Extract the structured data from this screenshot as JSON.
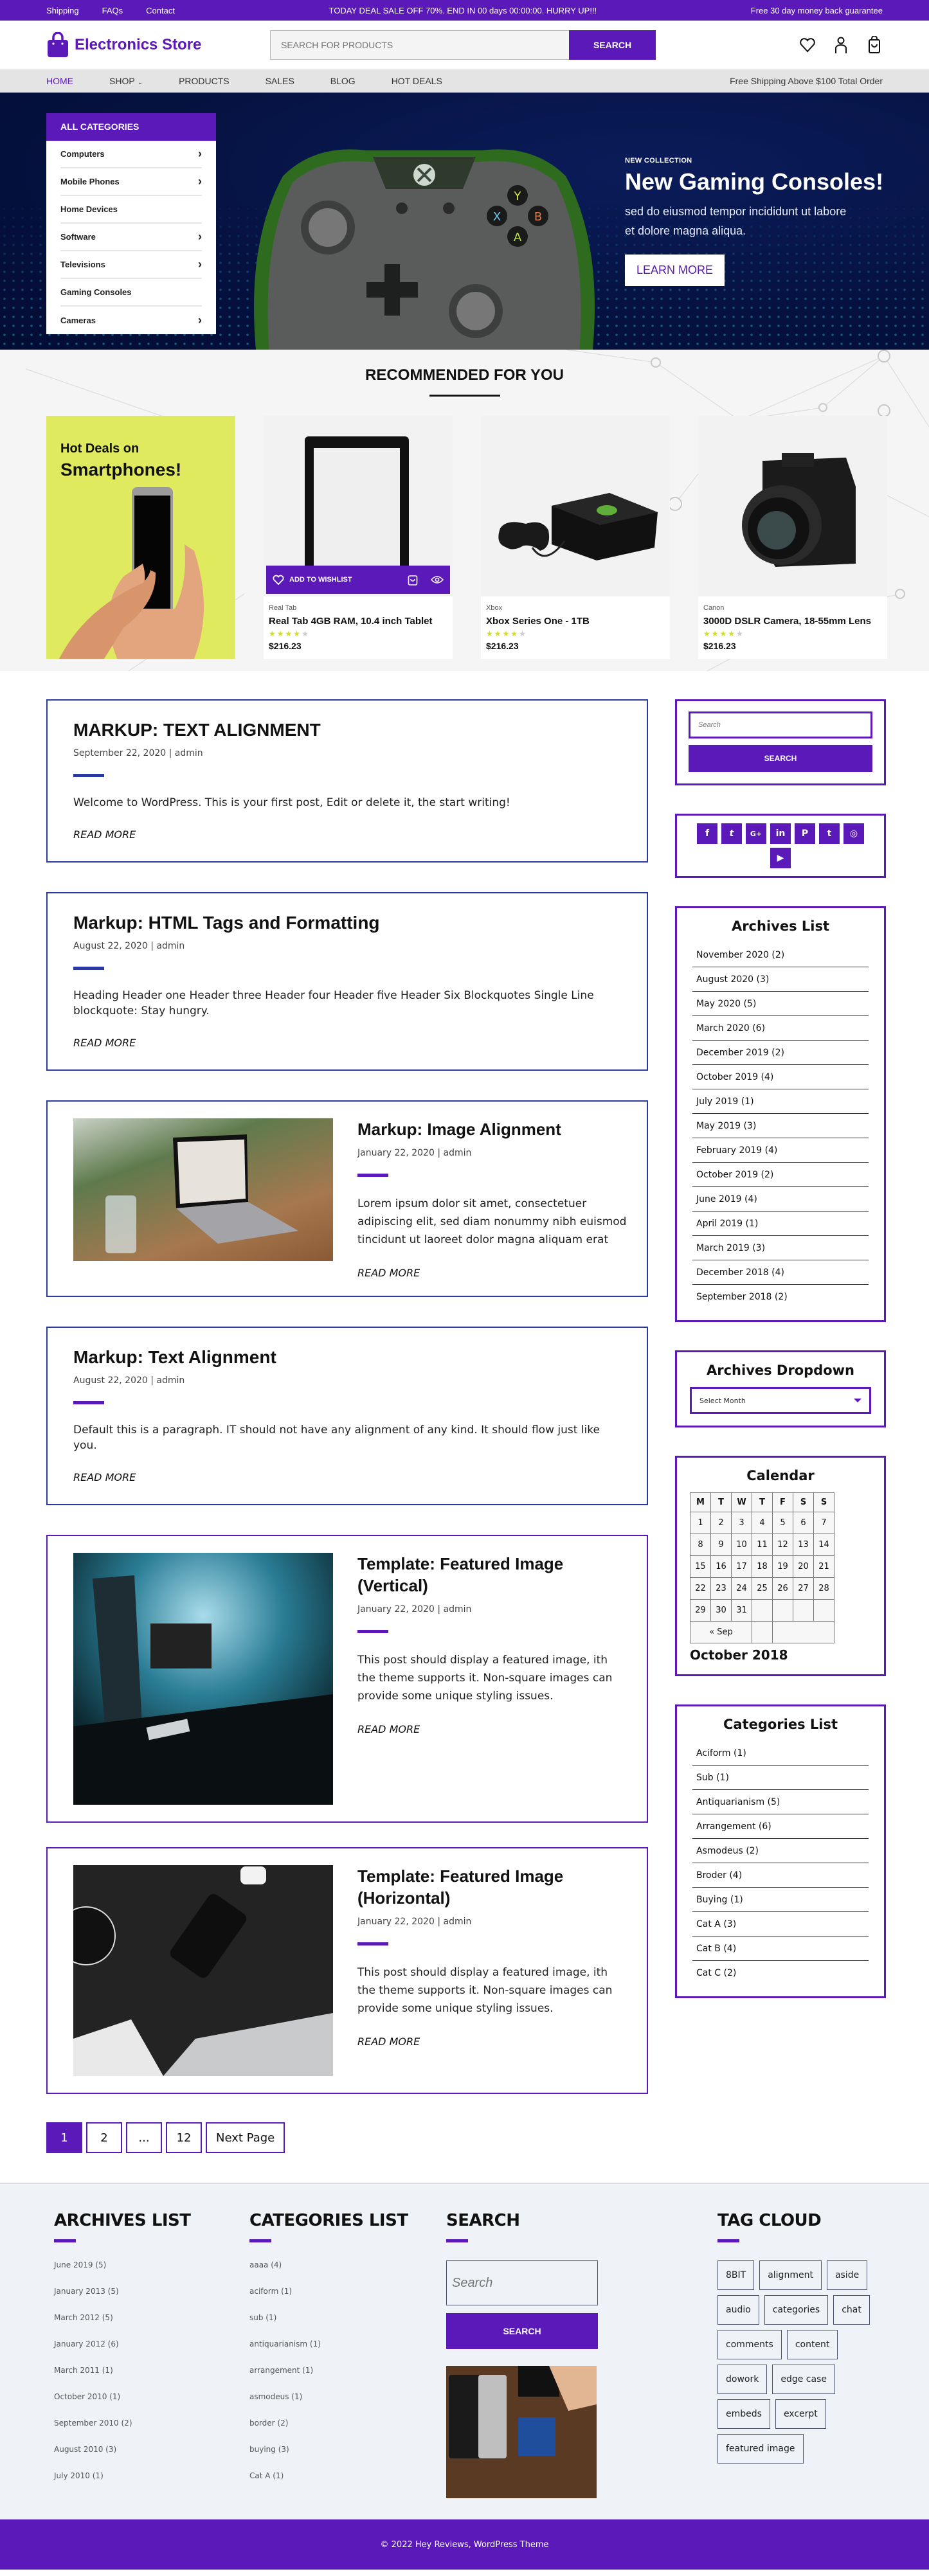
{
  "topbar": {
    "links": [
      "Shipping",
      "FAQs",
      "Contact"
    ],
    "promo": "TODAY DEAL SALE OFF 70%. END IN 00 days 00:00:00. HURRY UP!!!",
    "guarantee": "Free 30 day money back guarantee"
  },
  "header": {
    "store_name": "Electronics Store",
    "search_placeholder": "SEARCH FOR PRODUCTS",
    "search_button": "SEARCH",
    "icons": [
      "heart-icon",
      "user-icon",
      "cart-icon"
    ]
  },
  "nav": {
    "items": [
      "HOME",
      "SHOP",
      "PRODUCTS",
      "SALES",
      "BLOG",
      "HOT DEALS"
    ],
    "active": "HOME",
    "shipping_note": "Free Shipping Above $100 Total Order"
  },
  "hero": {
    "categories_title": "ALL CATEGORIES",
    "categories": [
      {
        "label": "Computers",
        "has_sub": true
      },
      {
        "label": "Mobile Phones",
        "has_sub": true
      },
      {
        "label": "Home Devices",
        "has_sub": false
      },
      {
        "label": "Software",
        "has_sub": true
      },
      {
        "label": "Televisions",
        "has_sub": true
      },
      {
        "label": "Gaming Consoles",
        "has_sub": false
      },
      {
        "label": "Cameras",
        "has_sub": true
      }
    ],
    "kicker": "NEW COLLECTION",
    "title": "New Gaming Consoles!",
    "description": "sed do eiusmod tempor incididunt ut labore et dolore magna aliqua.",
    "button": "LEARN MORE"
  },
  "recommended": {
    "title": "RECOMMENDED FOR YOU",
    "promo": {
      "line1": "Hot Deals on",
      "line2": "Smartphones!"
    },
    "wishlist_label": "ADD TO WISHLIST",
    "products": [
      {
        "brand": "Real Tab",
        "title": "Real Tab 4GB RAM, 10.4 inch Tablet",
        "rating": 4,
        "max_rating": 5,
        "price": "$216.23"
      },
      {
        "brand": "Xbox",
        "title": "Xbox Series One - 1TB",
        "rating": 4,
        "max_rating": 5,
        "price": "$216.23"
      },
      {
        "brand": "Canon",
        "title": "3000D DSLR Camera, 18-55mm Lens",
        "rating": 4,
        "max_rating": 5,
        "price": "$216.23"
      }
    ]
  },
  "posts": [
    {
      "title": "MARKUP: TEXT ALIGNMENT",
      "meta": "September 22, 2020 | admin",
      "excerpt": "Welcome to WordPress. This is your first post, Edit or delete it, the start writing!",
      "more": "READ MORE"
    },
    {
      "title": "Markup: HTML Tags and Formatting",
      "meta": "August 22, 2020 | admin",
      "excerpt": "Heading Header one Header three Header four Header five Header Six Blockquotes Single Line blockquote: Stay hungry.",
      "more": "READ MORE"
    },
    {
      "title": "Markup: Image Alignment",
      "meta": "January 22, 2020 | admin",
      "excerpt": "Lorem ipsum dolor sit amet, consectetuer adipiscing elit, sed diam nonummy nibh euismod tincidunt ut laoreet dolor magna aliquam erat",
      "more": "READ MORE"
    },
    {
      "title": "Markup: Text Alignment",
      "meta": "August 22, 2020 | admin",
      "excerpt": "Default this is a paragraph. IT should not have any alignment of any kind. It should flow just like you.",
      "more": "READ MORE"
    },
    {
      "title": "Template: Featured Image (Vertical)",
      "meta": "January 22, 2020 | admin",
      "excerpt": "This post should display a featured image, ith the theme supports it. Non-square images can provide some unique styling issues.",
      "more": "READ MORE"
    },
    {
      "title": "Template: Featured Image (Horizontal)",
      "meta": "January 22, 2020 | admin",
      "excerpt": "This post should display a featured image, ith the theme supports it. Non-square images can provide some unique styling issues.",
      "more": "READ MORE"
    }
  ],
  "pagination": {
    "pages": [
      "1",
      "2",
      "...",
      "12"
    ],
    "current": "1",
    "next": "Next Page"
  },
  "sidebar": {
    "search_placeholder": "Search",
    "search_button": "SEARCH",
    "social": [
      "facebook",
      "twitter",
      "google-plus",
      "linkedin",
      "pinterest",
      "tumblr",
      "instagram",
      "youtube"
    ],
    "archives_title": "Archives List",
    "archives": [
      "November 2020 (2)",
      "August 2020 (3)",
      "May 2020 (5)",
      "March 2020 (6)",
      "December 2019 (2)",
      "October 2019 (4)",
      "July 2019 (1)",
      "May 2019 (3)",
      "February 2019 (4)",
      "October 2019 (2)",
      "June 2019 (4)",
      "April 2019 (1)",
      "March 2019 (3)",
      "December 2018 (4)",
      "September 2018 (2)"
    ],
    "dropdown_title": "Archives Dropdown",
    "dropdown_value": "Select Month",
    "calendar_title": "Calendar",
    "calendar": {
      "weekdays": [
        "M",
        "T",
        "W",
        "T",
        "F",
        "S",
        "S"
      ],
      "weeks": [
        [
          "1",
          "2",
          "3",
          "4",
          "5",
          "6",
          "7"
        ],
        [
          "8",
          "9",
          "10",
          "11",
          "12",
          "13",
          "14"
        ],
        [
          "15",
          "16",
          "17",
          "18",
          "19",
          "20",
          "21"
        ],
        [
          "22",
          "23",
          "24",
          "25",
          "26",
          "27",
          "28"
        ],
        [
          "29",
          "30",
          "31",
          "",
          "",
          "",
          ""
        ]
      ],
      "prev": "« Sep",
      "caption": "October 2018"
    },
    "categories_title": "Categories List",
    "categories": [
      "Aciform (1)",
      "Sub (1)",
      "Antiquarianism (5)",
      "Arrangement (6)",
      "Asmodeus (2)",
      "Broder (4)",
      "Buying (1)",
      "Cat A (3)",
      "Cat B (4)",
      "Cat C (2)"
    ]
  },
  "footer": {
    "archives_title": "ARCHIVES LIST",
    "archives": [
      "June 2019 (5)",
      "January  2013 (5)",
      "March 2012 (5)",
      "January  2012 (6)",
      "March  2011 (1)",
      "October 2010 (1)",
      "September 2010 (2)",
      "August 2010 (3)",
      "July 2010 (1)"
    ],
    "categories_title": "CATEGORIES LIST",
    "categories": [
      "aaaa (4)",
      "aciform (1)",
      "sub (1)",
      "antiquarianism (1)",
      "arrangement (1)",
      "asmodeus (1)",
      "border (2)",
      "buying (3)",
      "Cat A (1)"
    ],
    "search_title": "SEARCH",
    "search_placeholder": "Search",
    "search_button": "SEARCH",
    "tags_title": "TAG CLOUD",
    "tags": [
      "8BIT",
      "alignment",
      "aside",
      "audio",
      "categories",
      "chat",
      "comments",
      "content",
      "dowork",
      "edge case",
      "embeds",
      "excerpt",
      "featured image"
    ],
    "copyright": "© 2022 Hey Reviews, WordPress Theme"
  },
  "colors": {
    "brand": "#5a19b8",
    "hero_bg": "#05113f",
    "promo_bg": "#e0ea5e",
    "star": "#d4df17",
    "post_border": "#2a3aa0"
  }
}
